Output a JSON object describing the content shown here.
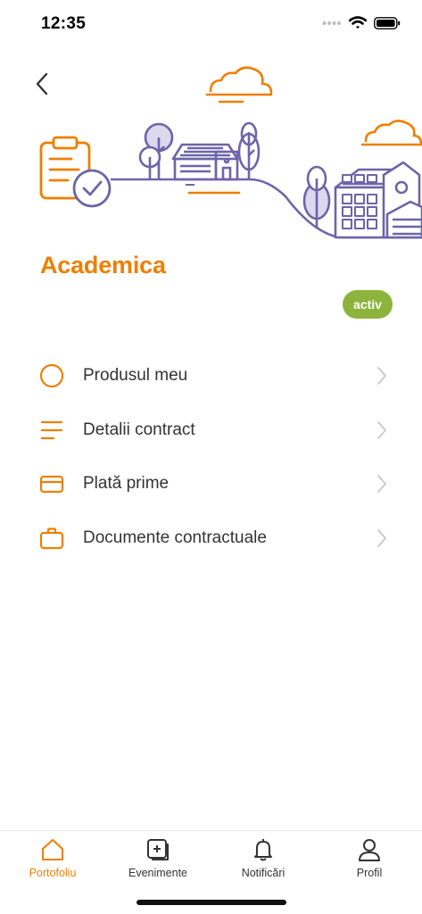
{
  "status_bar": {
    "time": "12:35"
  },
  "product": {
    "title": "Academica",
    "status": "activ"
  },
  "menu": [
    {
      "label": "Produsul meu",
      "icon": "circle-icon"
    },
    {
      "label": "Detalii contract",
      "icon": "lines-icon"
    },
    {
      "label": "Plată prime",
      "icon": "card-icon"
    },
    {
      "label": "Documente contractuale",
      "icon": "briefcase-icon"
    }
  ],
  "tabs": [
    {
      "label": "Portofoliu",
      "icon": "home-icon",
      "active": true
    },
    {
      "label": "Evenimente",
      "icon": "event-icon",
      "active": false
    },
    {
      "label": "Notificări",
      "icon": "bell-icon",
      "active": false
    },
    {
      "label": "Profil",
      "icon": "user-icon",
      "active": false
    }
  ],
  "colors": {
    "accent": "#ee7f00",
    "illustration": "#6e64a8",
    "badge": "#8cb43c"
  }
}
